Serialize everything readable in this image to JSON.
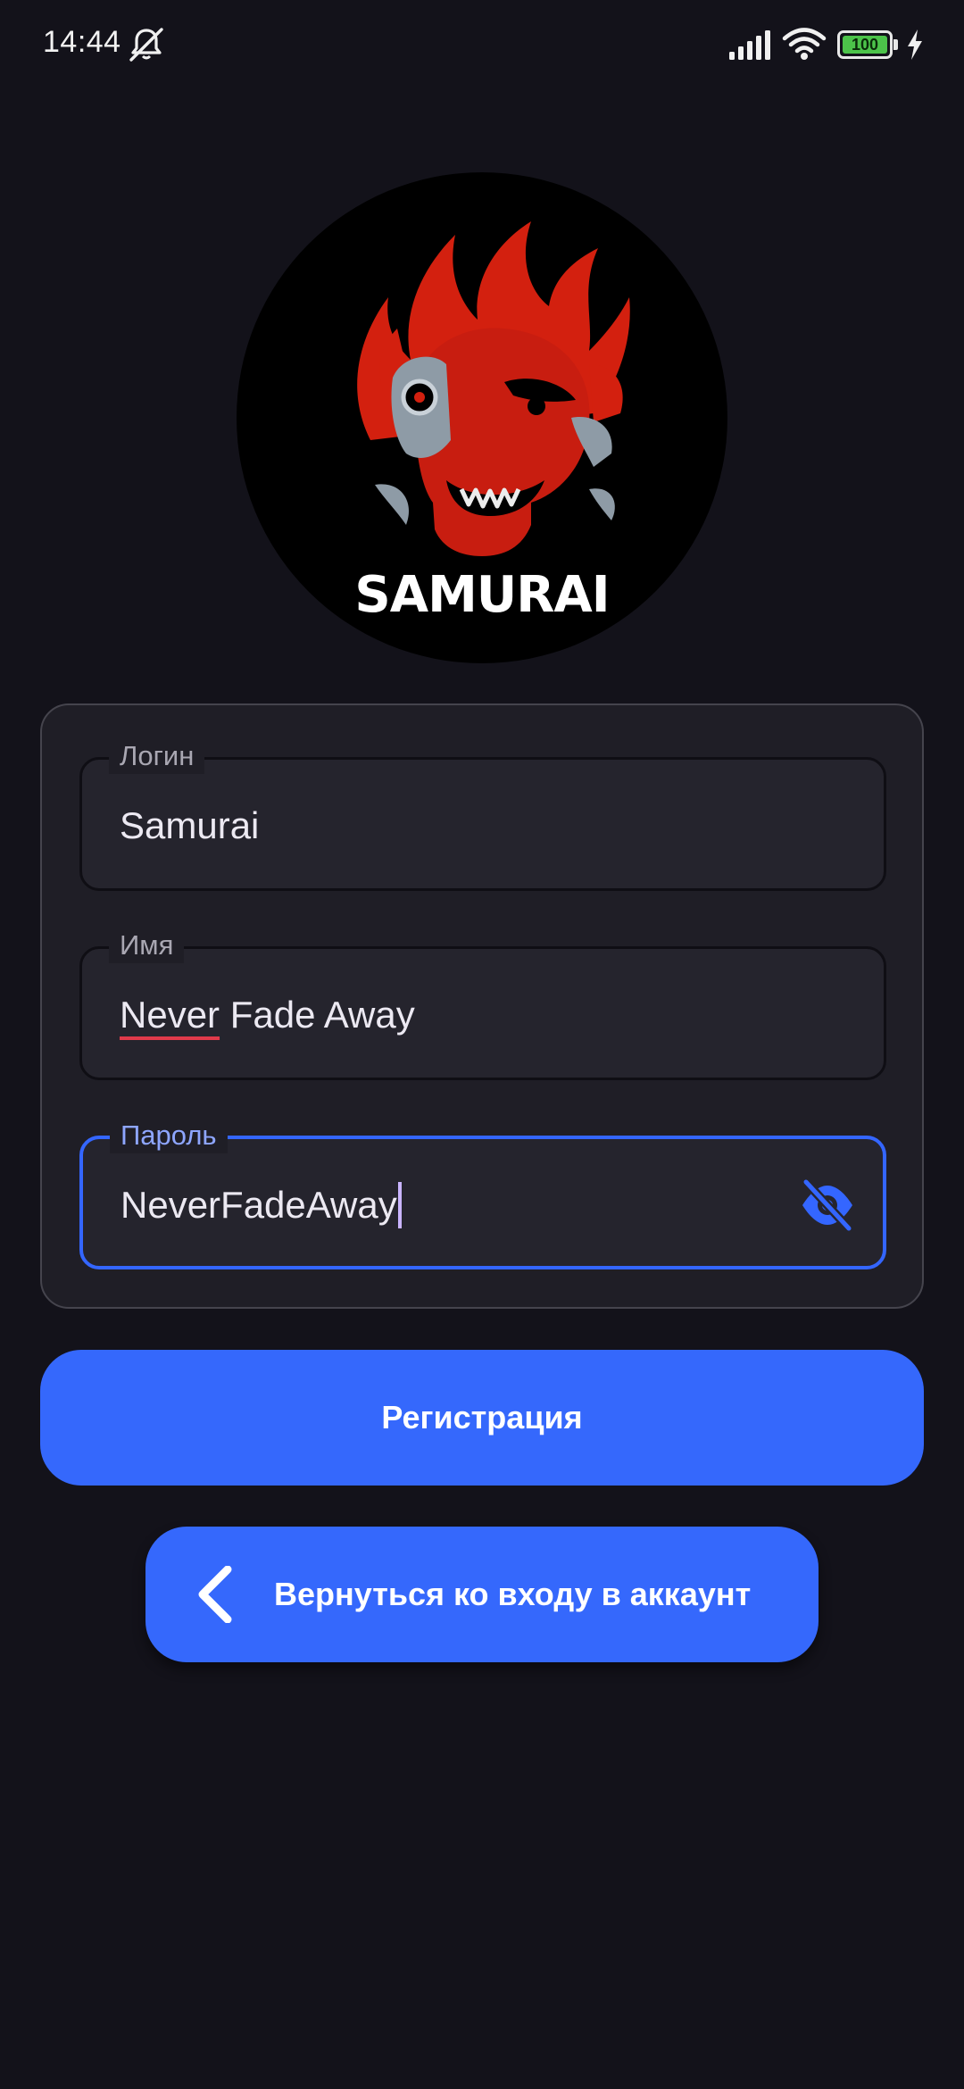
{
  "status_bar": {
    "time": "14:44",
    "battery_level": "100",
    "icons": [
      "mute-icon",
      "signal-icon",
      "wifi-icon",
      "battery-icon",
      "charging-icon"
    ]
  },
  "logo": {
    "text": "SAMURAI",
    "colors": {
      "background": "#000000",
      "flame": "#d3200f",
      "metal": "#8e9ba6",
      "text": "#ffffff"
    }
  },
  "form": {
    "login": {
      "label": "Логин",
      "value": "Samurai"
    },
    "name": {
      "label": "Имя",
      "value_first": "Never",
      "value_rest": " Fade Away"
    },
    "password": {
      "label": "Пароль",
      "value": "NeverFadeAway",
      "toggle_icon": "eye-off-icon"
    }
  },
  "buttons": {
    "register": "Регистрация",
    "back": "Вернуться ко входу в аккаунт",
    "back_icon": "chevron-left-icon"
  },
  "colors": {
    "background": "#13121a",
    "card": "#1f1e26",
    "accent": "#3568fc",
    "focused_label": "#8ea6ff"
  }
}
